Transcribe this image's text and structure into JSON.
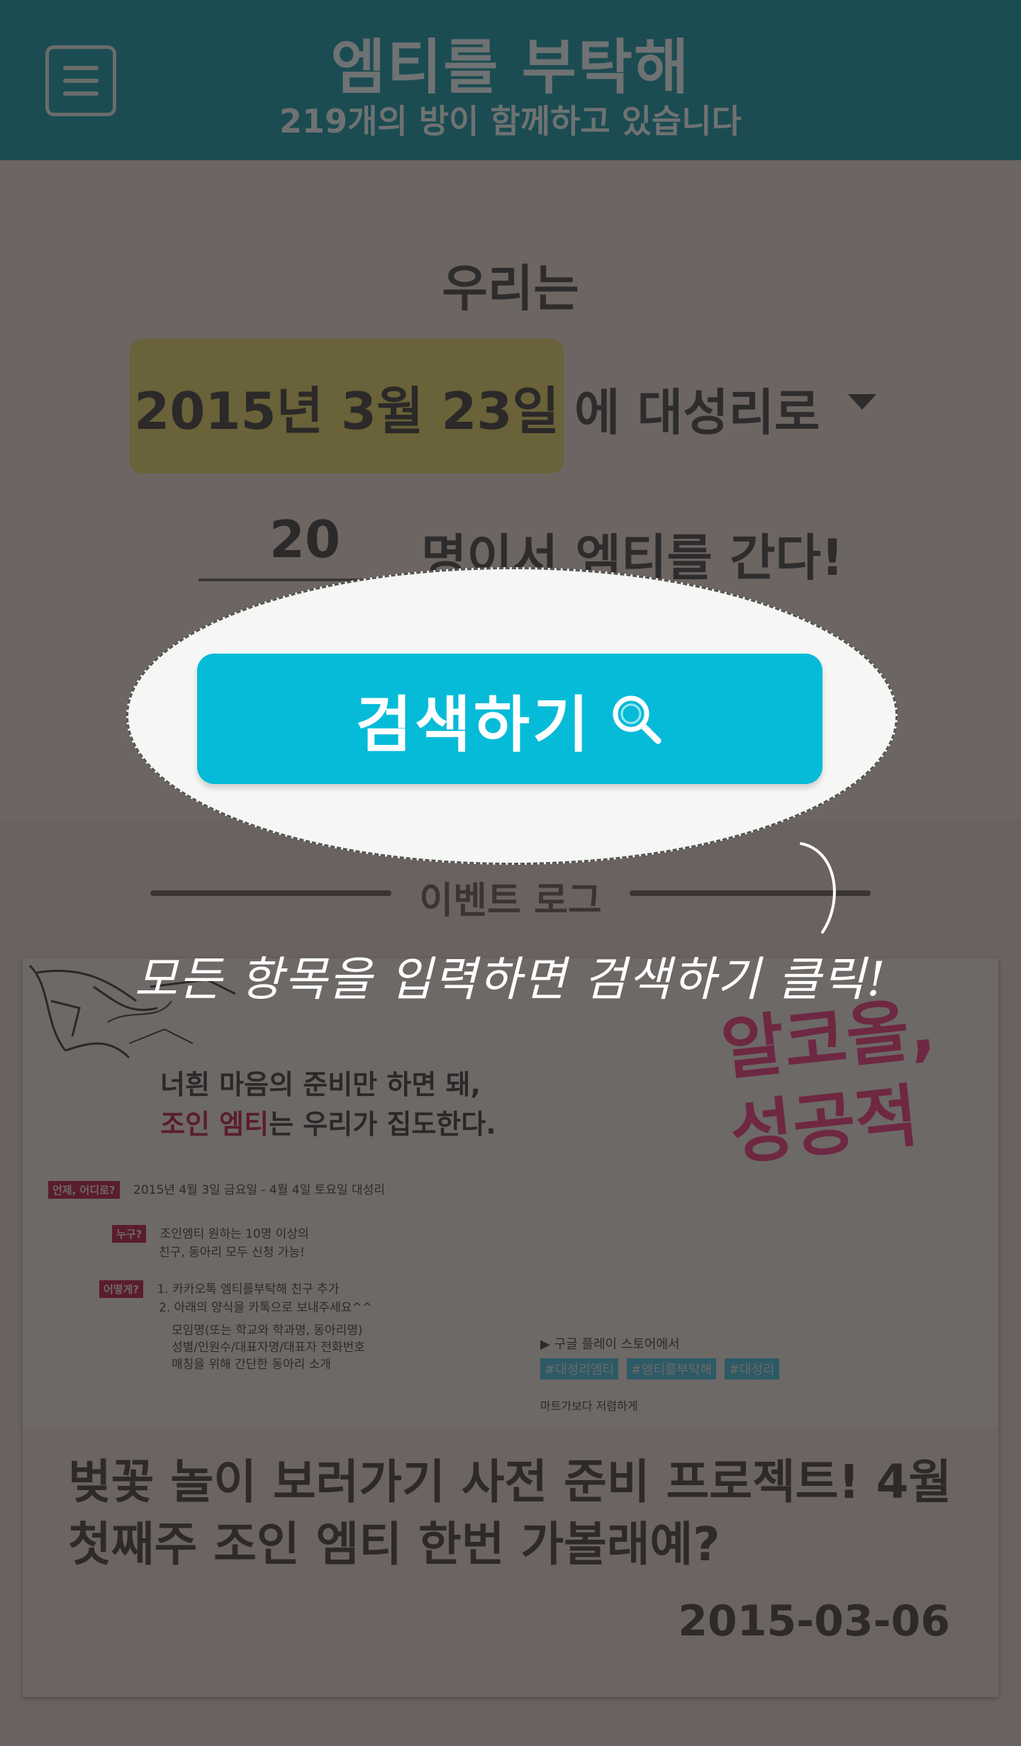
{
  "header": {
    "title": "엠티를 부탁해",
    "subtitle": "219개의 방이 함께하고 있습니다"
  },
  "search": {
    "intro": "우리는",
    "date": "2015년 3월 23일",
    "destination_suffix": "에 대성리로",
    "people_count": "20",
    "people_suffix": "명이서 엠티를 간다!",
    "button_label": "검색하기"
  },
  "event_log": {
    "title": "이벤트 로그"
  },
  "coach_mark": {
    "text": "모든 항목을 입력하면 검색하기 클릭!"
  },
  "event_card": {
    "poster": {
      "headline_line1": "너흰 마음의 준비만 하면 돼,",
      "headline_hl": "조인 엠티",
      "headline_line2_rest": "는 우리가 집도한다.",
      "big_text_line1": "알코올,",
      "big_text_line2": "성공적",
      "info": [
        {
          "tag": "언제, 어디로?",
          "lines": [
            "2015년 4월 3일 금요일 - 4월 4일 토요일  대성리"
          ]
        },
        {
          "tag": "누구?",
          "lines": [
            "조인엠티 원하는 10명 이상의",
            "친구, 동아리 모두 신청 가능!"
          ]
        },
        {
          "tag": "어떻게?",
          "lines": [
            "1. 카카오톡 엠티를부탁해 친구 추가",
            "2. 아래의 양식을 카톡으로 보내주세요^^",
            "   모임명(또는 학교와 학과명, 동아리명)",
            "   성별/인원수/대표자명/대표자 전화번호",
            "   매칭을 위해 간단한 동아리 소개"
          ]
        }
      ],
      "store_text": "▶ 구글 플레이 스토어에서",
      "hashtags": [
        "#대성리엠티",
        "#엠티를부탁해",
        "#대성리"
      ],
      "footer_text": "마트가보다 저렴하게"
    },
    "title": "벚꽃 놀이 보러가기 사전 준비 프로젝트! 4월 첫째주 조인 엠티 한번 가볼래예?",
    "date": "2015-03-06"
  },
  "colors": {
    "header_bg": "#1b4c52",
    "overlay_bg": "#6a6261",
    "button_accent": "#06bbd8",
    "date_highlight": "#6a6238"
  },
  "icons": {
    "menu": "hamburger-menu-icon",
    "search": "magnifier-icon",
    "dropdown": "triangle-down-icon"
  }
}
